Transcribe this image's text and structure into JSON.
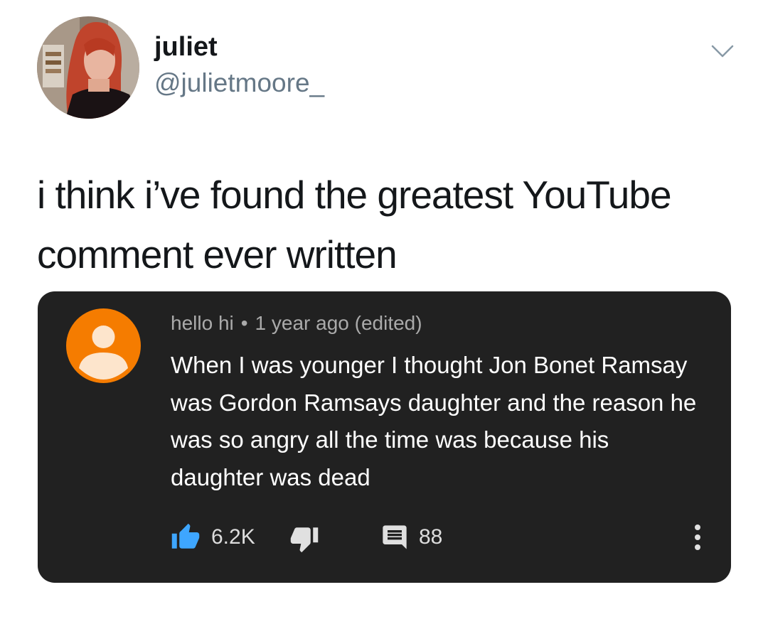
{
  "tweet": {
    "author": {
      "display_name": "juliet",
      "handle": "@julietmoore_",
      "avatar_icon": "profile-photo"
    },
    "menu_icon": "chevron-down-icon",
    "text": "i think i’ve found the greatest YouTube comment ever written"
  },
  "comment": {
    "author": "hello hi",
    "separator": "•",
    "timestamp": "1 year ago (edited)",
    "avatar_icon": "default-user-icon",
    "avatar_color": "#f57c00",
    "text": "When I was younger I thought Jon Bonet Ramsay was Gordon Ramsays daughter and the reason he was so angry all the time was because his daughter was dead",
    "likes": "6.2K",
    "replies": "88",
    "like_icon": "thumbs-up-icon",
    "like_color": "#3ea6ff",
    "dislike_icon": "thumbs-down-icon",
    "reply_icon": "comment-icon",
    "more_icon": "more-vertical-icon"
  }
}
